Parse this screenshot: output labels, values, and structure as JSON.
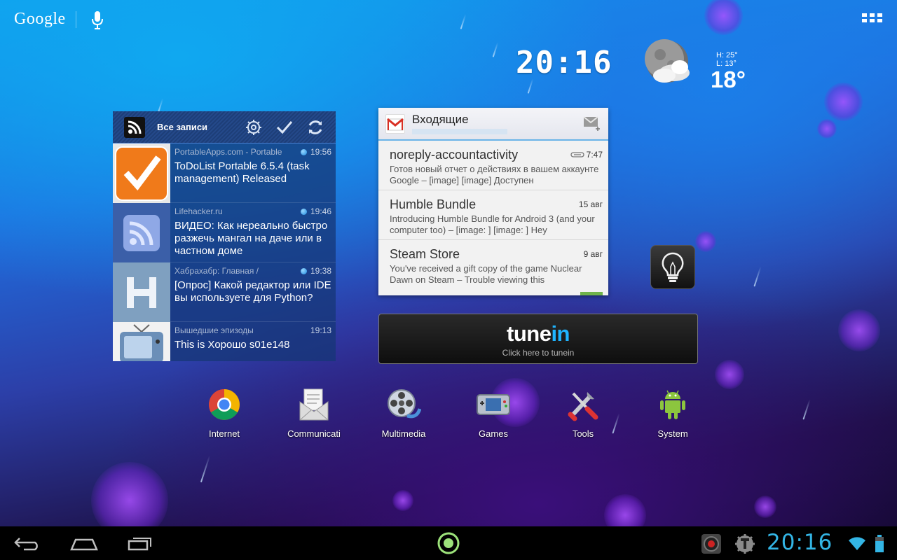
{
  "top_bar": {
    "search_logo": "Google",
    "mic_icon": "microphone-icon",
    "apps_icon": "all-apps-grid-icon"
  },
  "clock_widget": {
    "time": "20:16"
  },
  "weather_widget": {
    "icon": "moon-cloud-icon",
    "high": "H:  25°",
    "low": "L:  13°",
    "temp": "18°"
  },
  "rss_widget": {
    "title": "Все записи",
    "icons": [
      "rss-icon",
      "settings-icon",
      "check-icon",
      "refresh-icon"
    ],
    "items": [
      {
        "source": "PortableApps.com - Portable",
        "time": "19:56",
        "unread": true,
        "headline": "ToDoList Portable 6.5.4 (task management) Released",
        "thumb": "todolist-icon"
      },
      {
        "source": "Lifehacker.ru",
        "time": "19:46",
        "unread": true,
        "headline": "ВИДЕО: Как нереально быстро разжечь мангал на даче или в частном доме",
        "thumb": "rss-feed-icon"
      },
      {
        "source": "Хабрахабр: Главная /",
        "time": "19:38",
        "unread": true,
        "headline": "[Опрос] Какой редактор или IDE вы используете для Python?",
        "thumb": "habrahabr-icon"
      },
      {
        "source": "Вышедшие эпизоды",
        "time": "19:13",
        "unread": false,
        "headline": "This is Хорошо s01e148",
        "thumb": "tv-icon"
      }
    ]
  },
  "gmail_widget": {
    "title": "Входящие",
    "icons": [
      "gmail-icon",
      "compose-icon"
    ],
    "emails": [
      {
        "sender": "noreply-accountactivity",
        "date": "7:47",
        "attachment": true,
        "snippet": "Готов новый отчет о действиях в вашем аккаунте Google – [image] [image] Доступен"
      },
      {
        "sender": "Humble Bundle",
        "date": "15 авг",
        "attachment": false,
        "snippet": "Introducing Humble Bundle for Android 3 (and your computer too) – [image: ] [image: ] Hey"
      },
      {
        "sender": "Steam Store",
        "date": "9 авг",
        "attachment": false,
        "snippet": "You've received a gift copy of the game Nuclear Dawn on Steam – Trouble viewing this"
      }
    ]
  },
  "flashlight_widget": {
    "icon": "light-bulb-icon"
  },
  "tunein_widget": {
    "logo_a": "tune",
    "logo_b": "in",
    "subtitle": "Click here to tunein"
  },
  "apps": [
    {
      "label": "Internet",
      "icon": "chrome-icon"
    },
    {
      "label": "Communicati",
      "icon": "mail-envelope-icon"
    },
    {
      "label": "Multimedia",
      "icon": "film-reel-icon"
    },
    {
      "label": "Games",
      "icon": "gamepad-icon"
    },
    {
      "label": "Tools",
      "icon": "tools-icon"
    },
    {
      "label": "System",
      "icon": "android-icon"
    }
  ],
  "nav_bar": {
    "buttons": [
      "back-icon",
      "home-icon",
      "recents-icon"
    ],
    "center_icon": "launcher-home-indicator-icon",
    "status_icons": [
      "record-icon",
      "tasker-icon",
      "wifi-icon",
      "battery-icon"
    ],
    "clock": "20:16"
  },
  "colors": {
    "accent_blue": "#33b5e5",
    "gmail_red": "#d93025",
    "tunein_blue": "#1fb4ff"
  }
}
